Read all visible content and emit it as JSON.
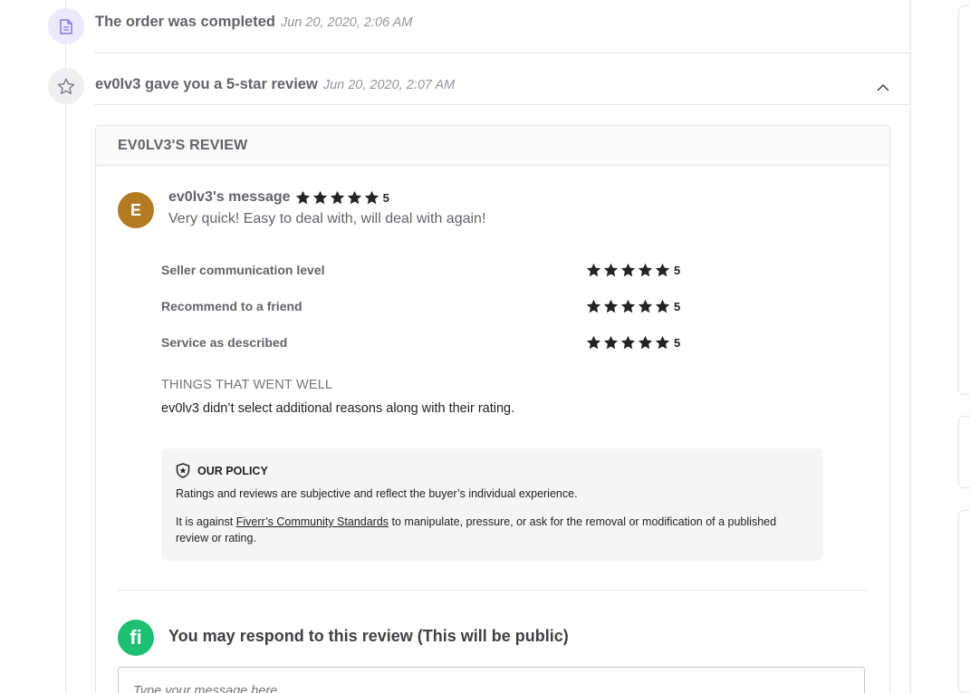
{
  "events": [
    {
      "title": "The order was completed",
      "date": "Jun 20, 2020, 2:06 AM",
      "icon": "document-icon"
    },
    {
      "title": "ev0lv3 gave you a 5-star review",
      "date": "Jun 20, 2020, 2:07 AM",
      "icon": "star-outline-icon"
    }
  ],
  "review": {
    "header": "EV0LV3'S REVIEW",
    "avatar_letter": "E",
    "avatar_color": "#b37a22",
    "message_label": "ev0lv3's message",
    "overall_rating": 5,
    "overall_score_text": "5",
    "message_text": "Very quick! Easy to deal with, will deal with again!",
    "criteria": [
      {
        "label": "Seller communication level",
        "rating": 5,
        "score_text": "5"
      },
      {
        "label": "Recommend to a friend",
        "rating": 5,
        "score_text": "5"
      },
      {
        "label": "Service as described",
        "rating": 5,
        "score_text": "5"
      }
    ],
    "went_well_title": "THINGS THAT WENT WELL",
    "went_well_text": "ev0lv3 didn’t select additional reasons along with their rating."
  },
  "policy": {
    "title": "OUR POLICY",
    "p1": "Ratings and reviews are subjective and reflect the buyer’s individual experience.",
    "p2_before": "It is against ",
    "p2_link": "Fiverr’s Community Standards",
    "p2_after": " to manipulate, pressure, or ask for the removal or modification of a published review or rating."
  },
  "respond": {
    "logo_text": "fi",
    "logo_color": "#1dbf73",
    "title": "You may respond to this review (This will be public)",
    "placeholder": "Type your message here..."
  }
}
